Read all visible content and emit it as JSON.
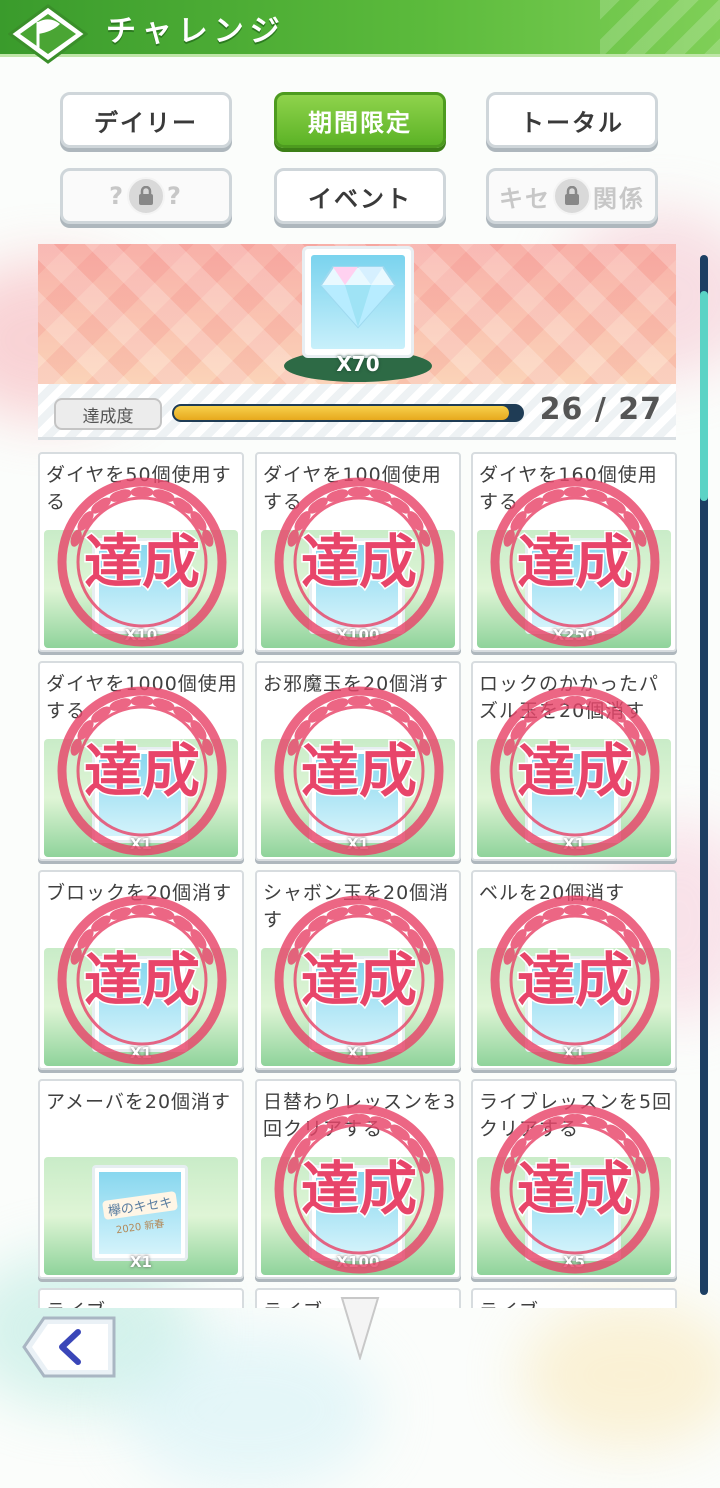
{
  "header": {
    "title": "チャレンジ"
  },
  "tabs": [
    {
      "label": "デイリー",
      "state": "normal"
    },
    {
      "label": "期間限定",
      "state": "active"
    },
    {
      "label": "トータル",
      "state": "normal"
    },
    {
      "label_left": "?",
      "label_right": "?",
      "state": "locked"
    },
    {
      "label": "イベント",
      "state": "normal"
    },
    {
      "label_left": "キセ",
      "label_right": "関係",
      "state": "locked"
    }
  ],
  "reward": {
    "icon": "diamond-icon",
    "quantity": "X70"
  },
  "progress": {
    "label": "達成度",
    "current": 26,
    "total": 27,
    "text": "26 / 27"
  },
  "stamp_text": "達成",
  "missions": [
    {
      "title": "ダイヤを50個使用する",
      "reward_icon": "diamond-icon",
      "quantity": "X10",
      "achieved": true
    },
    {
      "title": "ダイヤを100個使用する",
      "reward_icon": "diamond-icon",
      "quantity": "X100",
      "achieved": true
    },
    {
      "title": "ダイヤを160個使用する",
      "reward_icon": "diamond-icon",
      "quantity": "X250",
      "achieved": true
    },
    {
      "title": "ダイヤを1000個使用する",
      "reward_icon": "ticket-icon",
      "quantity": "X1",
      "achieved": true
    },
    {
      "title": "お邪魔玉を20個消す",
      "reward_icon": "ticket-icon",
      "quantity": "X1",
      "achieved": true
    },
    {
      "title": "ロックのかかったパズル玉を20個消す",
      "reward_icon": "ticket-icon",
      "quantity": "X1",
      "achieved": true
    },
    {
      "title": "ブロックを20個消す",
      "reward_icon": "ticket-icon",
      "quantity": "X1",
      "achieved": true
    },
    {
      "title": "シャボン玉を20個消す",
      "reward_icon": "ticket-icon",
      "quantity": "X1",
      "achieved": true
    },
    {
      "title": "ベルを20個消す",
      "reward_icon": "ticket-icon",
      "quantity": "X1",
      "achieved": true
    },
    {
      "title": "アメーバを20個消す",
      "reward_icon": "ticket-icon",
      "ticket_text": "欅のキセキ",
      "ticket_sub": "2020 新春",
      "quantity": "X1",
      "achieved": false
    },
    {
      "title": "日替わりレッスンを3回クリアする",
      "reward_icon": "crystal-icon",
      "quantity": "X100",
      "achieved": true
    },
    {
      "title": "ライブレッスンを5回クリアする",
      "reward_icon": "shield-icon",
      "quantity": "X5",
      "achieved": true
    },
    {
      "title": "ライブ",
      "reward_icon": "",
      "quantity": "",
      "achieved": false
    },
    {
      "title": "ライブ",
      "reward_icon": "",
      "quantity": "",
      "achieved": false
    },
    {
      "title": "ライブ",
      "reward_icon": "",
      "quantity": "",
      "achieved": false
    }
  ],
  "colors": {
    "header": "#5cbb3c",
    "active_tab": "#6cc033",
    "stamp": "#e8456a",
    "progress_fill": "#f0c23a"
  }
}
